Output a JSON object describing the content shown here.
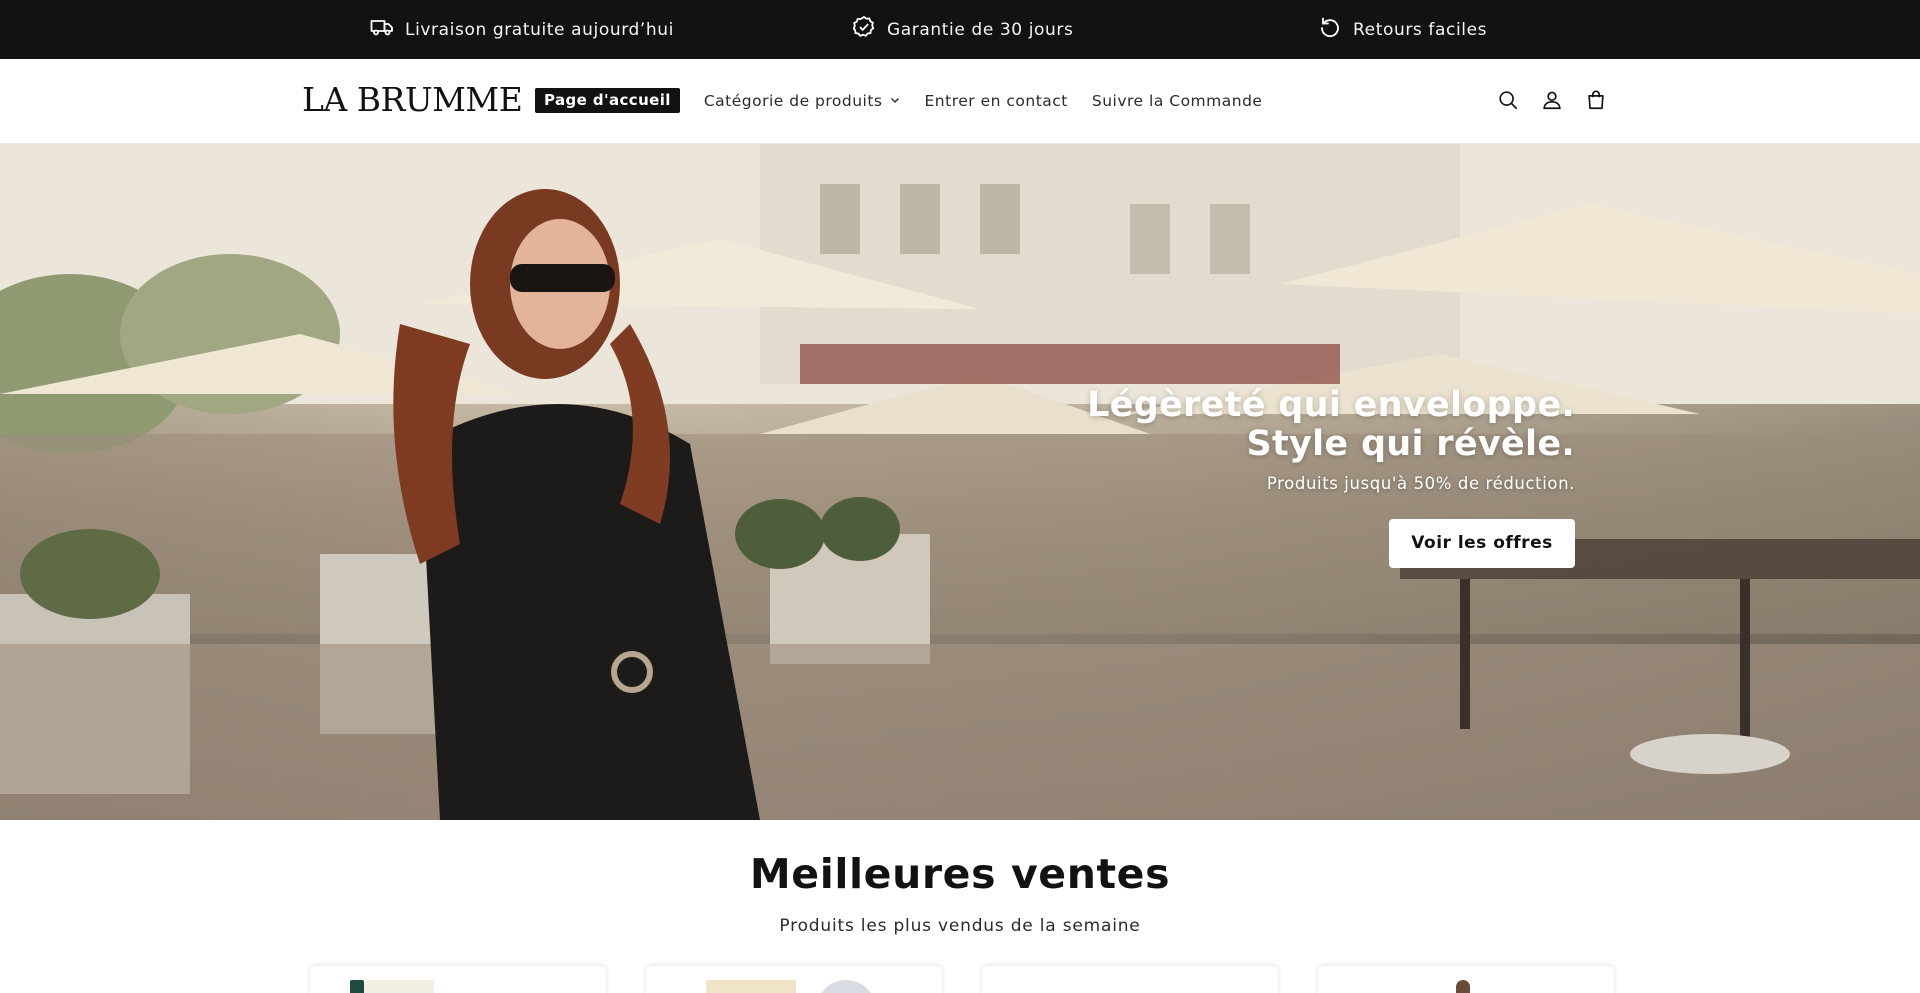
{
  "announcement": {
    "items": [
      {
        "label": "Livraison gratuite aujourd’hui",
        "icon": "truck-icon"
      },
      {
        "label": "Garantie de 30 jours",
        "icon": "badge-check-icon"
      },
      {
        "label": "Retours faciles",
        "icon": "return-arrow-icon"
      }
    ]
  },
  "header": {
    "logo": "LA BRUMME",
    "nav": [
      {
        "label": "Page d'accueil",
        "active": true
      },
      {
        "label": "Catégorie de produits",
        "has_dropdown": true
      },
      {
        "label": "Entrer en contact"
      },
      {
        "label": "Suivre la Commande"
      }
    ],
    "icons": [
      "search-icon",
      "account-icon",
      "cart-icon"
    ]
  },
  "hero": {
    "title_line1": "Légèreté qui enveloppe.",
    "title_line2": "Style qui révèle.",
    "subtitle": "Produits jusqu'à 50% de réduction.",
    "button": "Voir les offres"
  },
  "bestsellers": {
    "title": "Meilleures ventes",
    "subtitle": "Produits les plus vendus de la semaine",
    "card_count": 4
  },
  "colors": {
    "announcement_bg": "#121212",
    "text": "#121212",
    "button_bg": "#ffffff"
  }
}
